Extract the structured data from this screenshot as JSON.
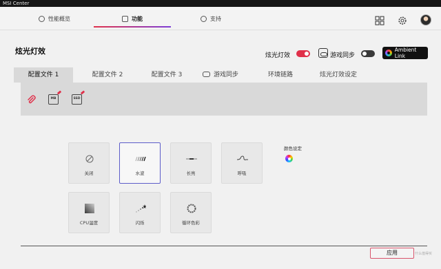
{
  "window": {
    "title": "MSI Center"
  },
  "nav": {
    "tabs": [
      {
        "label": "性能概览",
        "icon": "gauge-icon"
      },
      {
        "label": "功能",
        "icon": "feature-icon"
      },
      {
        "label": "支持",
        "icon": "info-icon"
      }
    ],
    "active_tab": "功能",
    "right_icons": [
      "grid-icon",
      "gear-icon",
      "avatar"
    ]
  },
  "header": {
    "title": "炫光灯效",
    "mystic_light_label": "炫光灯效",
    "mystic_light_on": true,
    "game_sync_label": "游戏同步",
    "game_sync_on": false,
    "ambient_link_label": "Ambient Link"
  },
  "profile_tabs": [
    {
      "label": "配置文件 1",
      "active": true
    },
    {
      "label": "配置文件 2"
    },
    {
      "label": "配置文件 3"
    },
    {
      "label": "游戏同步",
      "icon": "gamepad-icon"
    },
    {
      "label": "环境链路"
    },
    {
      "label": "炫光灯效设定"
    }
  ],
  "devices": [
    {
      "name": "link-icon"
    },
    {
      "name": "mb-icon",
      "text": "MB"
    },
    {
      "name": "ssd-icon",
      "text": "SSD"
    }
  ],
  "effects": [
    {
      "label": "关闭",
      "icon": "off-icon"
    },
    {
      "label": "水波",
      "icon": "wave-icon",
      "selected": true
    },
    {
      "label": "长亮",
      "icon": "steady-icon"
    },
    {
      "label": "呼吸",
      "icon": "breathing-icon"
    },
    {
      "label": "CPU温度",
      "icon": "cpu-temp-icon"
    },
    {
      "label": "闪烁",
      "icon": "flashing-icon"
    },
    {
      "label": "循环色彩",
      "icon": "color-cycle-icon"
    }
  ],
  "color_settings": {
    "label": "颜色设定"
  },
  "footer": {
    "apply_label": "应用",
    "watermark": "什么值得买"
  },
  "colors": {
    "accent": "#e0304a",
    "selected_border": "#5b5bc9"
  }
}
